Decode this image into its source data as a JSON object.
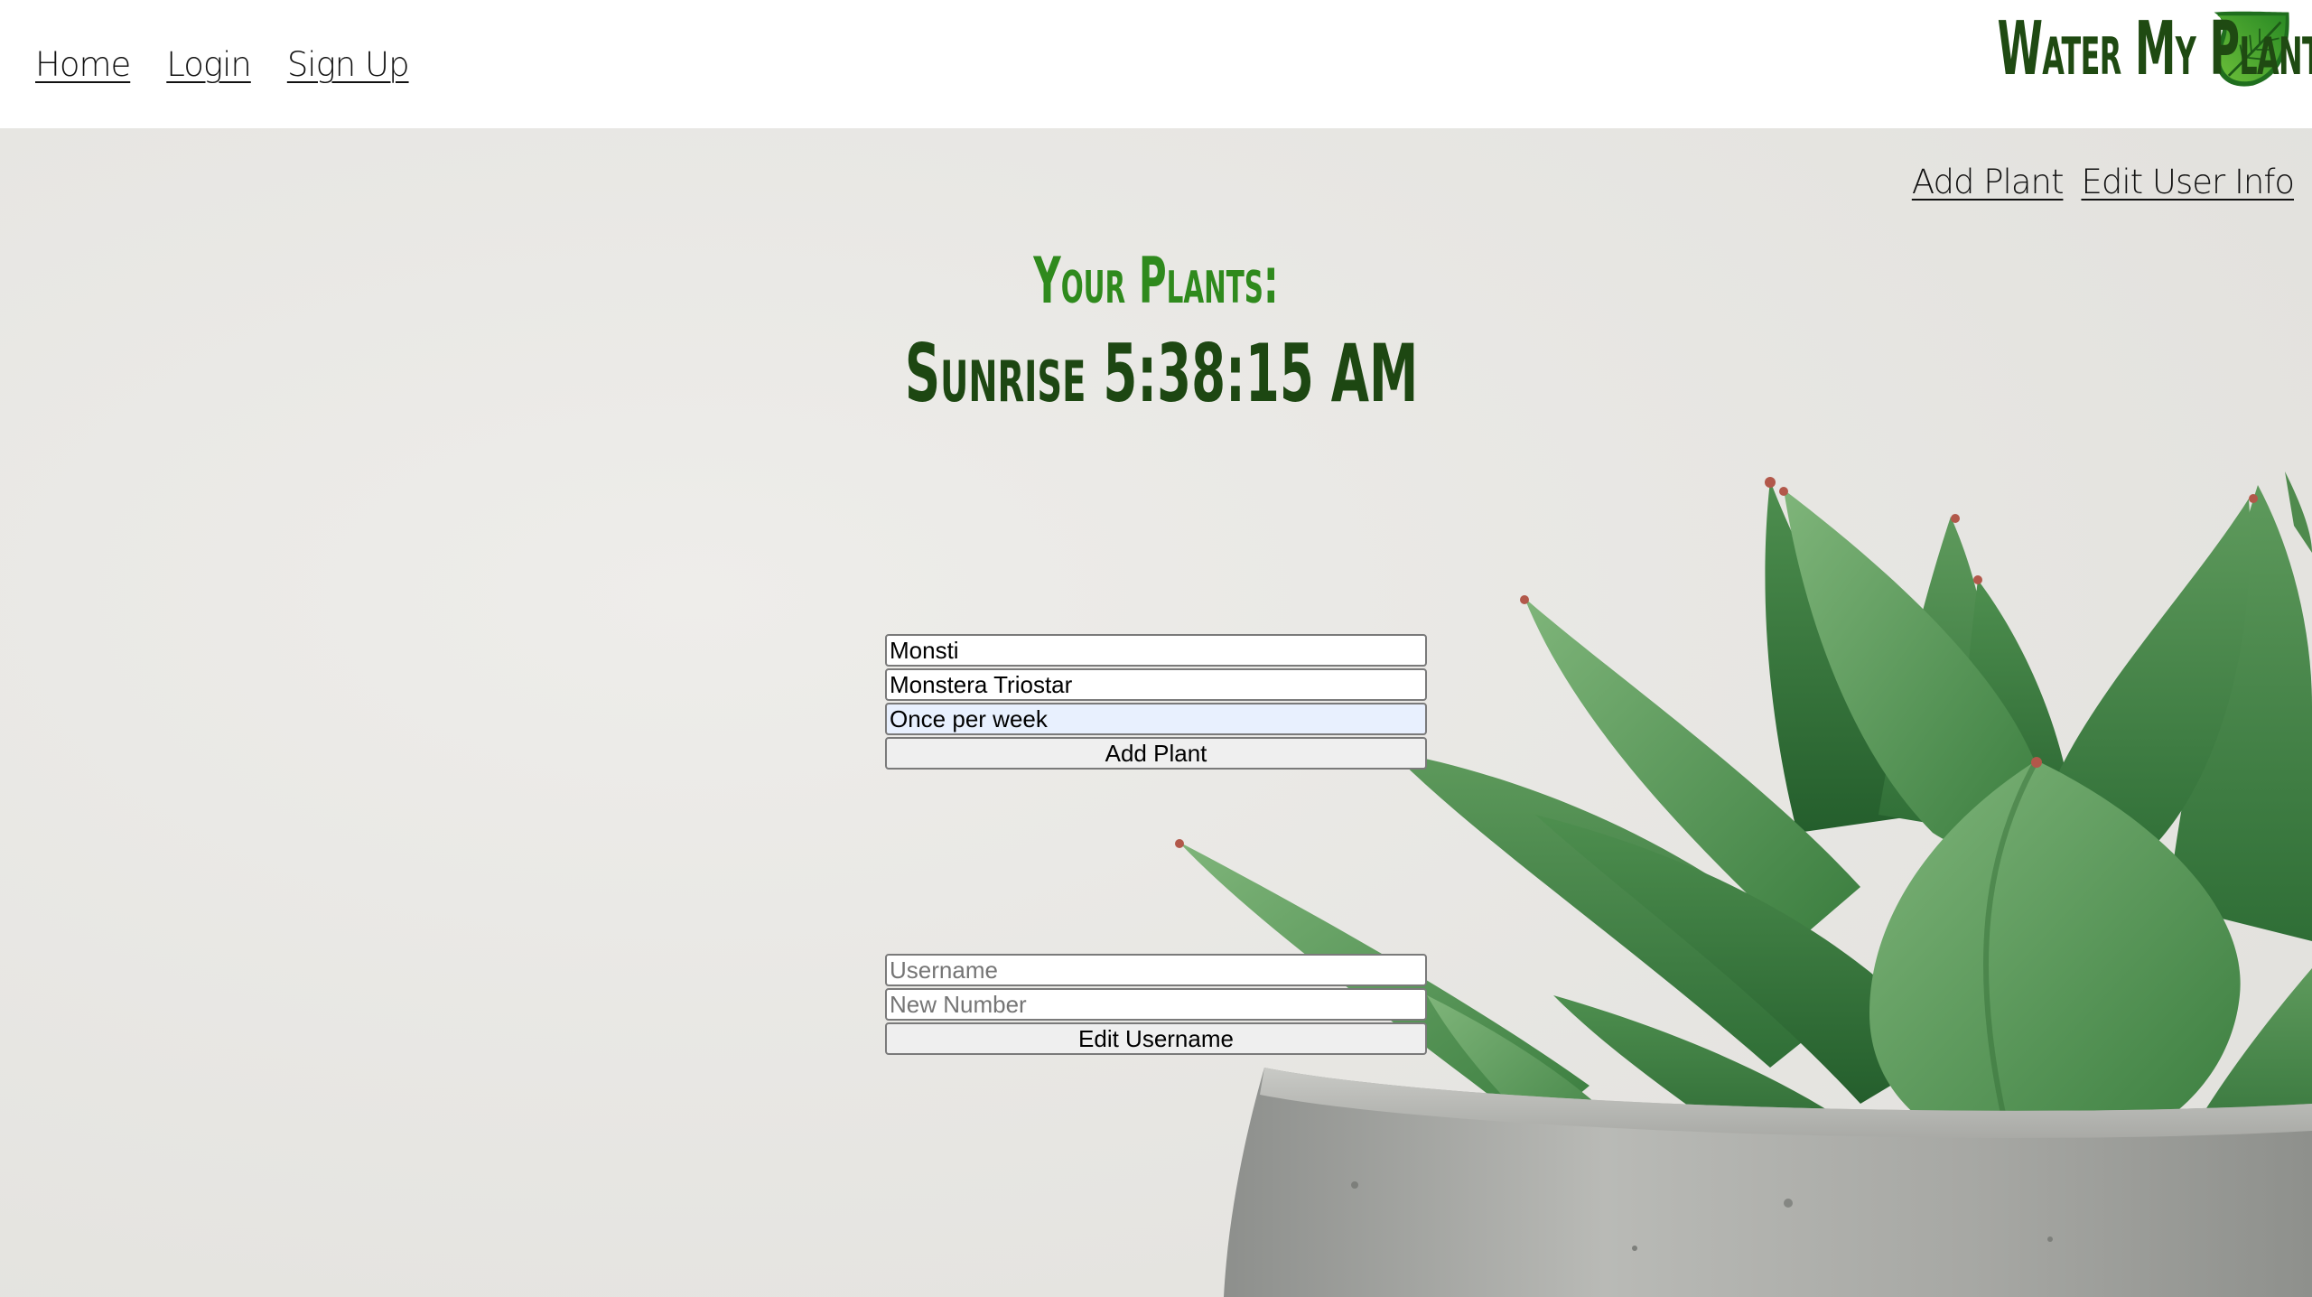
{
  "header": {
    "nav": [
      {
        "label": "Home"
      },
      {
        "label": "Login"
      },
      {
        "label": "Sign Up"
      }
    ],
    "brand_title": "Water My Plants",
    "logo_icon": "leaf-icon"
  },
  "subnav": {
    "add_plant": "Add Plant",
    "edit_user_info": "Edit User Info"
  },
  "main": {
    "your_plants_heading": "Your Plants:",
    "sunrise_text": "Sunrise 5:38:15 AM"
  },
  "add_plant_form": {
    "nickname_value": "Monsti",
    "species_value": "Monstera Triostar",
    "frequency_value": "Once per week",
    "submit_label": "Add Plant"
  },
  "edit_user_form": {
    "username_placeholder": "Username",
    "number_placeholder": "New Number",
    "submit_label": "Edit Username"
  },
  "colors": {
    "brand_dark_green": "#1f4a12",
    "heading_green": "#2f8a1d",
    "background": "#e9e8e5",
    "header_background": "#ffffff"
  }
}
